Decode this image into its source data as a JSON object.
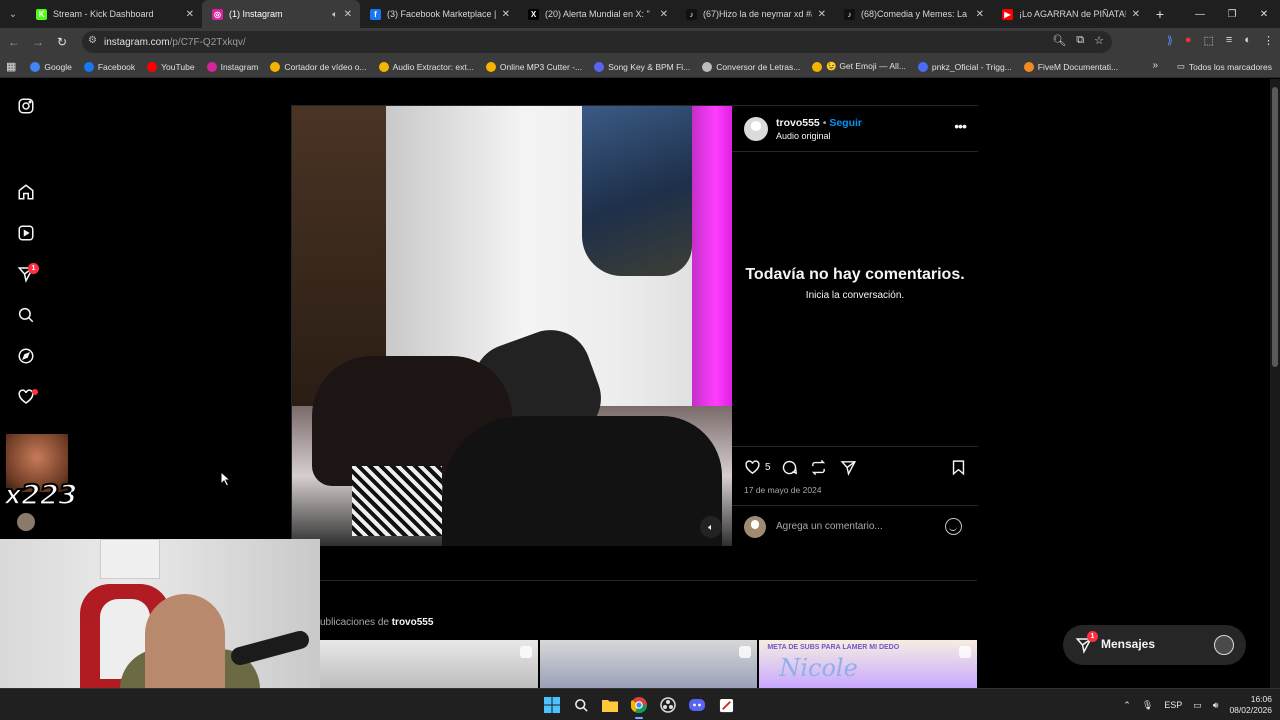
{
  "browser": {
    "tabs": [
      {
        "title": "Stream - Kick Dashboard",
        "color": "#53fc18",
        "glyph": "K",
        "active": false
      },
      {
        "title": "(1) Instagram",
        "color": "#d6249f",
        "glyph": "◎",
        "active": true
      },
      {
        "title": "(3) Facebook Marketplace | Fac",
        "color": "#1877f2",
        "glyph": "f",
        "active": false
      },
      {
        "title": "(20) Alerta Mundial en X: \"",
        "color": "#000000",
        "glyph": "X",
        "active": false
      },
      {
        "title": "(67)Hizo la de neymar xd #acu",
        "color": "#111111",
        "glyph": "♪",
        "active": false
      },
      {
        "title": "(68)Comedia y Memes: La Dive",
        "color": "#111111",
        "glyph": "♪",
        "active": false
      },
      {
        "title": "¡Lo AGARRAN de PIÑATA!",
        "color": "#ff0000",
        "glyph": "▶",
        "active": false
      }
    ],
    "url_host": "instagram.com",
    "url_path": "/p/C7F-Q2Txkqv/",
    "bookmarks": [
      {
        "label": "Google",
        "color": "#4285f4"
      },
      {
        "label": "Facebook",
        "color": "#1877f2"
      },
      {
        "label": "YouTube",
        "color": "#ff0000"
      },
      {
        "label": "Instagram",
        "color": "#d6249f"
      },
      {
        "label": "Cortador de vídeo o...",
        "color": "#f4b400"
      },
      {
        "label": "Audio Extractor: ext...",
        "color": "#f4b400"
      },
      {
        "label": "Online MP3 Cutter -...",
        "color": "#f4b400"
      },
      {
        "label": "Song Key & BPM Fi...",
        "color": "#5865f2"
      },
      {
        "label": "Conversor de Letras...",
        "color": "#bbbbbb"
      },
      {
        "label": "😉 Get Emoji — All...",
        "color": "#f4b400"
      },
      {
        "label": "pnkz_Oficial - Trigg...",
        "color": "#4a6cf7"
      },
      {
        "label": "FiveM Documentati...",
        "color": "#f48a1f"
      }
    ],
    "all_bookmarks": "Todos los marcadores"
  },
  "sidebar": {
    "notification_count": "1"
  },
  "post": {
    "username": "trovo555",
    "separator": "•",
    "follow": "Seguir",
    "audio": "Audio original",
    "more": "•••",
    "empty_title": "Todavía no hay comentarios.",
    "empty_sub": "Inicia la conversación.",
    "likes": "5",
    "date": "17 de mayo de 2024",
    "comment_placeholder": "Agrega un comentario...",
    "more_from_prefix": "ublicaciones de",
    "more_from_user": "trovo555",
    "thumb3_caption": "META DE SUBS PARA LAMER MI DEDO",
    "thumb3_title": "Nicole"
  },
  "messages": {
    "label": "Mensajes",
    "count": "1"
  },
  "overlay": {
    "text": "x223"
  },
  "taskbar": {
    "lang": "ESP",
    "time": "16:06",
    "date": "08/02/2026"
  }
}
